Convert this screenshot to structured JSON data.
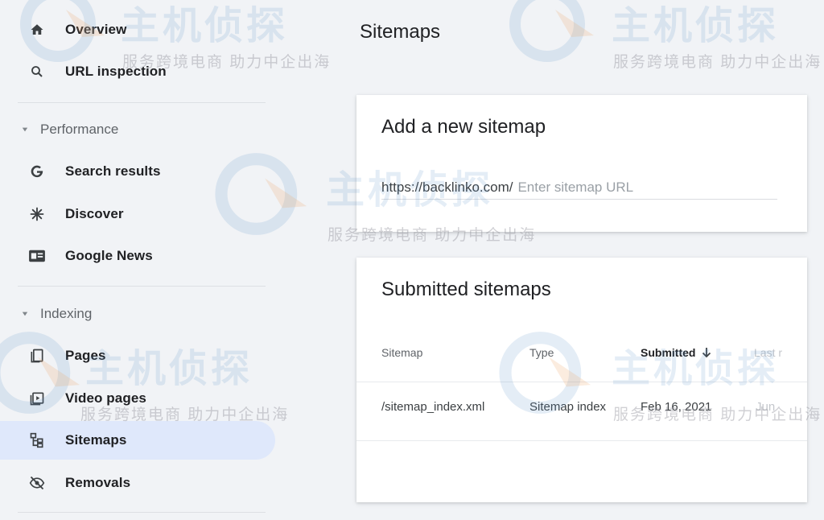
{
  "sidebar": {
    "items_top": [
      {
        "label": "Overview",
        "icon": "home-icon"
      },
      {
        "label": "URL inspection",
        "icon": "search-icon"
      }
    ],
    "sections": [
      {
        "label": "Performance",
        "items": [
          {
            "label": "Search results",
            "icon": "google-g-icon"
          },
          {
            "label": "Discover",
            "icon": "asterisk-icon"
          },
          {
            "label": "Google News",
            "icon": "news-icon"
          }
        ]
      },
      {
        "label": "Indexing",
        "items": [
          {
            "label": "Pages",
            "icon": "pages-icon"
          },
          {
            "label": "Video pages",
            "icon": "video-pages-icon"
          },
          {
            "label": "Sitemaps",
            "icon": "sitemap-icon",
            "active": true
          },
          {
            "label": "Removals",
            "icon": "removals-icon"
          }
        ]
      }
    ]
  },
  "main": {
    "title": "Sitemaps",
    "add_card": {
      "title": "Add a new sitemap",
      "url_prefix": "https://backlinko.com/",
      "placeholder": "Enter sitemap URL"
    },
    "submitted_card": {
      "title": "Submitted sitemaps",
      "columns": [
        "Sitemap",
        "Type",
        "Submitted",
        "Last r"
      ],
      "rows": [
        {
          "sitemap": "/sitemap_index.xml",
          "type": "Sitemap index",
          "submitted": "Feb 16, 2021",
          "last_read": "Jun"
        }
      ]
    }
  },
  "watermark": {
    "brand": "主机侦探",
    "tagline": "服务跨境电商 助力中企出海"
  },
  "colors": {
    "active_nav_bg": "#dfe8fb",
    "page_bg": "#f1f3f6",
    "watermark": "#5a8cc8"
  }
}
